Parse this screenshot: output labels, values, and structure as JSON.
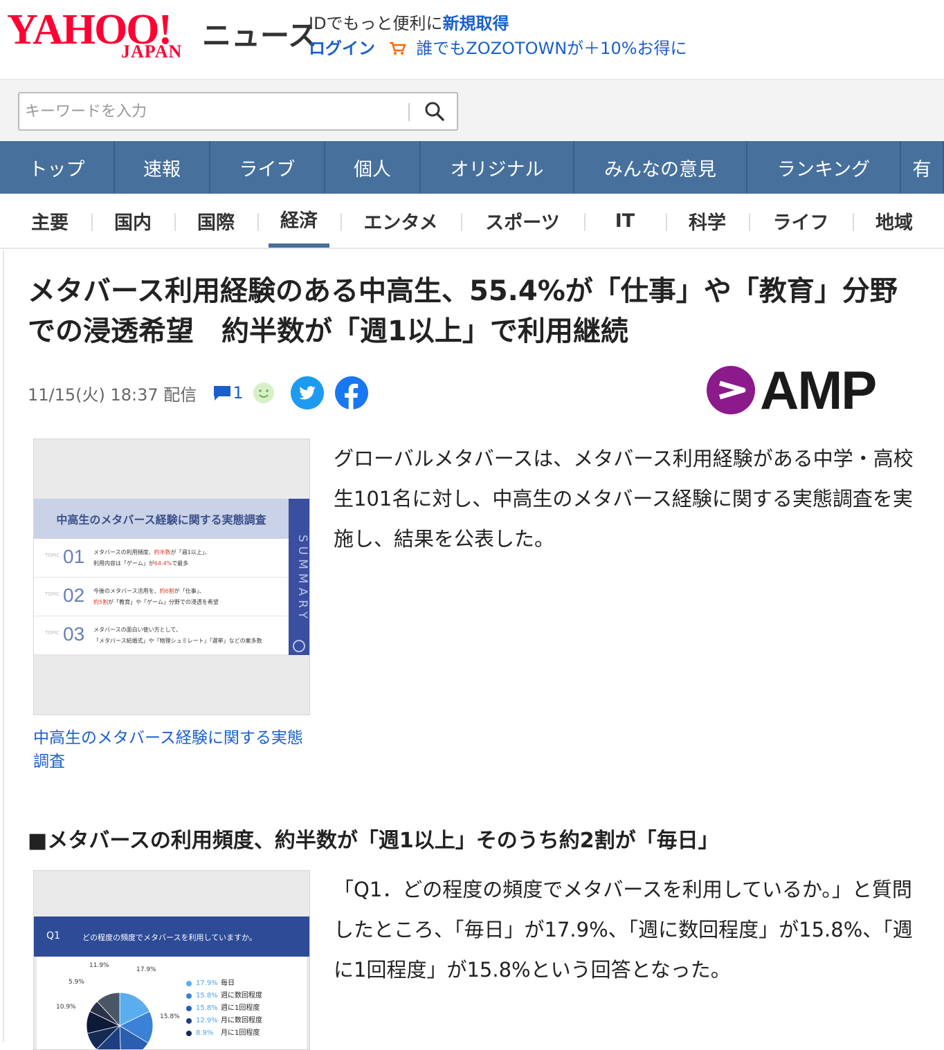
{
  "header": {
    "logo_text": "YAHOO!",
    "logo_sub": "JAPAN",
    "section_title": "ニュース",
    "promo_prefix": "IDでもっと便利に",
    "promo_link": "新規取得",
    "login_label": "ログイン",
    "zozo_promo": "誰でもZOZOTOWNが＋10%お得に"
  },
  "search": {
    "placeholder": "キーワードを入力"
  },
  "main_nav": [
    {
      "label": "トップ",
      "active": true
    },
    {
      "label": "速報"
    },
    {
      "label": "ライブ"
    },
    {
      "label": "個人"
    },
    {
      "label": "オリジナル"
    },
    {
      "label": "みんなの意見"
    },
    {
      "label": "ランキング"
    },
    {
      "label": "有"
    }
  ],
  "sub_nav": [
    {
      "label": "主要"
    },
    {
      "label": "国内"
    },
    {
      "label": "国際"
    },
    {
      "label": "経済",
      "active": true
    },
    {
      "label": "エンタメ"
    },
    {
      "label": "スポーツ"
    },
    {
      "label": "IT"
    },
    {
      "label": "科学"
    },
    {
      "label": "ライフ"
    },
    {
      "label": "地域"
    }
  ],
  "article": {
    "headline": "メタバース利用経験のある中高生、55.4%が「仕事」や「教育」分野での浸透希望　約半数が「週1以上」で利用継続",
    "date": "11/15(火) 18:37 配信",
    "comment_count": "1",
    "source_logo": "AMP",
    "figure1": {
      "title": "中高生のメタバース経験に関する実態調査",
      "side_label": "SUMMARY",
      "topic_label": "TOPIC",
      "topics": [
        {
          "num": "01",
          "line1_a": "メタバースの利用頻度、",
          "line1_em": "約半数",
          "line1_b": "が「週1以上」、",
          "line2_a": "利用内容は「ゲーム」が",
          "line2_em": "64.4%",
          "line2_b": "で最多"
        },
        {
          "num": "02",
          "line1_a": "今後のメタバース活用を、",
          "line1_em": "約6割",
          "line1_b": "が「仕事」、",
          "line2_a": "",
          "line2_em": "約5割",
          "line2_b": "が「教育」や「ゲーム」分野での浸透を希望"
        },
        {
          "num": "03",
          "line1_a": "メタバースの面白い使い方として、",
          "line1_em": "",
          "line1_b": "",
          "line2_a": "「メタバース結婚式」や「物理シュミレート」「選挙」などの案多数",
          "line2_em": "",
          "line2_b": ""
        }
      ],
      "caption": "中高生のメタバース経験に関する実態調査"
    },
    "paragraph1": "グローバルメタバースは、メタバース利用経験がある中学・高校生101名に対し、中高生のメタバース経験に関する実態調査を実施し、結果を公表した。",
    "sub_heading": "■メタバースの利用頻度、約半数が「週1以上」そのうち約2割が「毎日」",
    "figure2": {
      "q_num": "Q1",
      "q_text": "どの程度の頻度でメタバースを利用していますか。"
    },
    "paragraph2": "「Q1．どの程度の頻度でメタバースを利用しているか。」と質問したところ、「毎日」が17.9%、「週に数回程度」が15.8%、「週に1回程度」が15.8%という回答となった。"
  },
  "chart_data": {
    "type": "pie",
    "categories": [
      "毎日",
      "週に数回程度",
      "週に1回程度",
      "月に数回程度",
      "月に1回程度",
      "",
      ""
    ],
    "values": [
      17.9,
      15.8,
      15.8,
      12.9,
      8.9,
      10.9,
      5.9,
      11.9
    ],
    "legend": [
      {
        "pct": "17.9%",
        "label": "毎日",
        "color": "#5aaef0"
      },
      {
        "pct": "15.8%",
        "label": "週に数回程度",
        "color": "#3b82d6"
      },
      {
        "pct": "15.8%",
        "label": "週に1回程度",
        "color": "#2a5fb0"
      },
      {
        "pct": "12.9%",
        "label": "月に数回程度",
        "color": "#1d3f80"
      },
      {
        "pct": "8.9%",
        "label": "月に1回程度",
        "color": "#142a55"
      }
    ],
    "slice_labels": [
      "17.9%",
      "15.8%",
      "10.9%",
      "5.9%",
      "11.9%"
    ],
    "colors": [
      "#5aaef0",
      "#3b82d6",
      "#2a5fb0",
      "#1d3f80",
      "#142a55",
      "#0c1a36",
      "#28334a",
      "#4a5568"
    ]
  },
  "colors": {
    "brand_red": "#ff0033",
    "nav_blue": "#47709c",
    "nav_active": "#3d4c5e",
    "link_blue": "#1a5fcc"
  }
}
